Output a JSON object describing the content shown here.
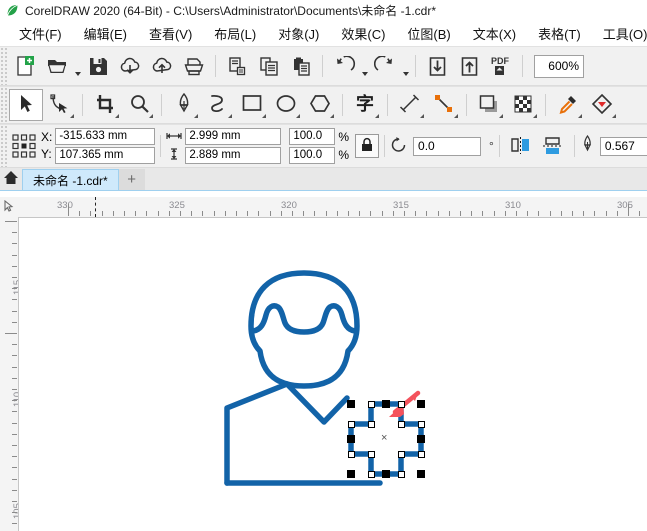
{
  "window": {
    "title": "CorelDRAW 2020 (64-Bit) - C:\\Users\\Administrator\\Documents\\未命名 -1.cdr*",
    "logo_icon": "coreldraw-balloon-icon"
  },
  "menubar": {
    "items": [
      {
        "label": "文件(F)",
        "name": "menu-file"
      },
      {
        "label": "编辑(E)",
        "name": "menu-edit"
      },
      {
        "label": "查看(V)",
        "name": "menu-view"
      },
      {
        "label": "布局(L)",
        "name": "menu-layout"
      },
      {
        "label": "对象(J)",
        "name": "menu-object"
      },
      {
        "label": "效果(C)",
        "name": "menu-effects"
      },
      {
        "label": "位图(B)",
        "name": "menu-bitmaps"
      },
      {
        "label": "文本(X)",
        "name": "menu-text"
      },
      {
        "label": "表格(T)",
        "name": "menu-table"
      },
      {
        "label": "工具(O)",
        "name": "menu-tools"
      }
    ]
  },
  "standard_toolbar": {
    "buttons": [
      {
        "icon": "new-document-icon",
        "name": "new-document-button"
      },
      {
        "icon": "open-folder-icon",
        "name": "open-document-button"
      },
      {
        "icon": "save-icon",
        "name": "save-document-button"
      },
      {
        "icon": "cloud-download-icon",
        "name": "cloud-download-button"
      },
      {
        "icon": "cloud-upload-icon",
        "name": "cloud-upload-button"
      },
      {
        "icon": "print-icon",
        "name": "print-button"
      },
      {
        "icon": "cut-icon",
        "name": "cut-button"
      },
      {
        "icon": "copy-icon",
        "name": "copy-button"
      },
      {
        "icon": "paste-icon",
        "name": "paste-button"
      },
      {
        "icon": "undo-icon",
        "name": "undo-button"
      },
      {
        "icon": "redo-icon",
        "name": "redo-button"
      },
      {
        "icon": "import-icon",
        "name": "import-button"
      },
      {
        "icon": "export-icon",
        "name": "export-button"
      },
      {
        "icon": "pdf-icon",
        "name": "publish-pdf-button"
      }
    ],
    "zoom_level": "600%"
  },
  "toolbox": {
    "tools": [
      {
        "icon": "pick-tool-icon",
        "name": "tool-pick",
        "active": true
      },
      {
        "icon": "shape-tool-icon",
        "name": "tool-shape",
        "active": false
      },
      {
        "icon": "crop-tool-icon",
        "name": "tool-crop",
        "active": false
      },
      {
        "icon": "zoom-tool-icon",
        "name": "tool-zoom",
        "active": false
      },
      {
        "icon": "pen-tool-icon",
        "name": "tool-pen",
        "active": false
      },
      {
        "icon": "freehand-tool-icon",
        "name": "tool-freehand",
        "active": false
      },
      {
        "icon": "rectangle-tool-icon",
        "name": "tool-rectangle",
        "active": false
      },
      {
        "icon": "ellipse-tool-icon",
        "name": "tool-ellipse",
        "active": false
      },
      {
        "icon": "polygon-tool-icon",
        "name": "tool-polygon",
        "active": false
      },
      {
        "icon": "text-tool-icon",
        "name": "tool-text",
        "active": false
      },
      {
        "icon": "dimension-tool-icon",
        "name": "tool-dimension",
        "active": false
      },
      {
        "icon": "connector-tool-icon",
        "name": "tool-connector",
        "active": false
      },
      {
        "icon": "shadow-tool-icon",
        "name": "tool-shadow",
        "active": false
      },
      {
        "icon": "transparency-tool-icon",
        "name": "tool-transparency",
        "active": false
      },
      {
        "icon": "eyedropper-tool-icon",
        "name": "tool-color-eyedropper",
        "active": false
      },
      {
        "icon": "fill-tool-icon",
        "name": "tool-interactive-fill",
        "active": false
      }
    ]
  },
  "property_bar": {
    "position_icon": "object-origin-icon",
    "x_label": "X:",
    "y_label": "Y:",
    "x_value": "-315.633 mm",
    "y_value": "107.365 mm",
    "width_icon": "width-arrows-icon",
    "height_icon": "height-arrows-icon",
    "width_value": "2.999 mm",
    "height_value": "2.889 mm",
    "scale_x": "100.0",
    "scale_y": "100.0",
    "percent_symbol": "%",
    "lock_icon": "lock-ratio-icon",
    "rotate_icon": "rotate-icon",
    "rotation_value": "0.0",
    "degree_symbol": "°",
    "mirror_h_icon": "mirror-horizontal-icon",
    "mirror_v_icon": "mirror-vertical-icon",
    "outline_icon": "outline-pen-icon",
    "outline_width": "0.567"
  },
  "tabbar": {
    "home_icon": "home-icon",
    "document_tab": "未命名 -1.cdr*",
    "add_tab_label": "+"
  },
  "rulers": {
    "units": "mm",
    "horizontal_labels": [
      "330",
      "325",
      "320",
      "315",
      "310",
      "305"
    ],
    "vertical_labels": [
      "115",
      "110",
      "105"
    ],
    "origin_icon": "ruler-origin-icon"
  },
  "canvas": {
    "drawing": {
      "stroke_color": "#1263A8",
      "objects": [
        {
          "name": "head-shape",
          "type": "avatar-head-outline"
        },
        {
          "name": "hair-shape",
          "type": "avatar-hair-outline"
        },
        {
          "name": "body-shape",
          "type": "avatar-shoulders-polyline"
        },
        {
          "name": "cross-shape",
          "type": "plus-cross-outline",
          "selected": true
        }
      ]
    },
    "selection": {
      "handle_color": "#000000",
      "node_color": "#ffffff",
      "center_marker": "×"
    },
    "annotation": {
      "name": "red-arrow-annotation",
      "color": "#F4525C",
      "points_to": "cross-shape"
    }
  }
}
